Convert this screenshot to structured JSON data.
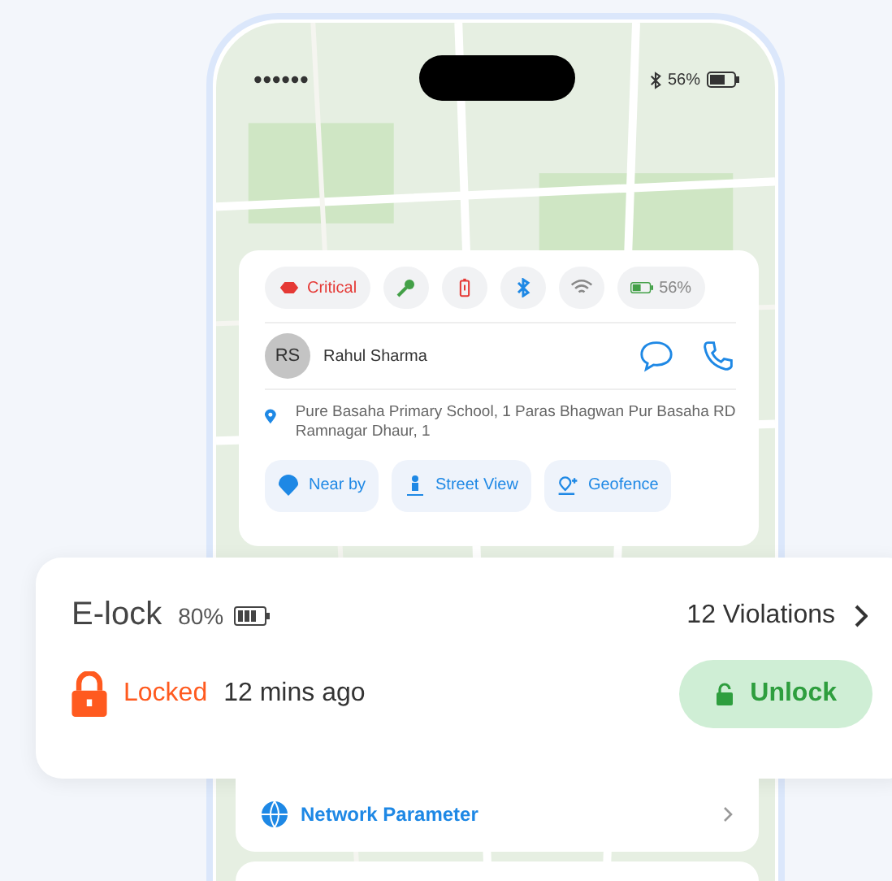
{
  "status_bar": {
    "battery": "56%"
  },
  "device_card": {
    "chips": [
      {
        "kind": "critical",
        "label": "Critical"
      },
      {
        "kind": "key"
      },
      {
        "kind": "battery_alert"
      },
      {
        "kind": "bluetooth"
      },
      {
        "kind": "wifi"
      },
      {
        "kind": "battery",
        "label": "56%"
      }
    ],
    "driver": {
      "initials": "RS",
      "name": "Rahul Sharma"
    },
    "address": "Pure Basaha Primary School, 1 Paras Bhagwan Pur Basaha RD Ramnagar Dhaur, 1",
    "actions": [
      {
        "kind": "nearby",
        "label": "Near by"
      },
      {
        "kind": "street_view",
        "label": "Street View"
      },
      {
        "kind": "geofence",
        "label": "Geofence"
      }
    ]
  },
  "elock": {
    "title": "E-lock",
    "battery": "80%",
    "violations": "12 Violations",
    "status": "Locked",
    "time": "12 mins ago",
    "button": "Unlock"
  },
  "network": {
    "label": "Network Parameter"
  }
}
